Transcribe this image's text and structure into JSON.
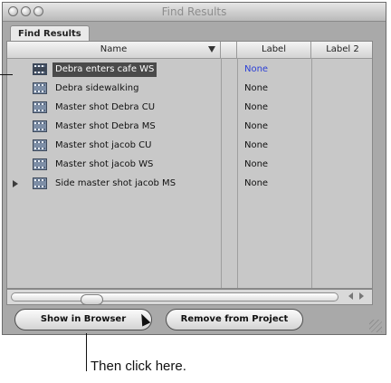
{
  "window": {
    "title": "Find Results"
  },
  "tab": {
    "label": "Find Results"
  },
  "table": {
    "headers": {
      "name": "Name",
      "label": "Label",
      "label2": "Label 2"
    },
    "rows": [
      {
        "name": "Debra enters cafe WS",
        "label": "None",
        "selected": true,
        "expandable": false
      },
      {
        "name": "Debra sidewalking",
        "label": "None",
        "selected": false,
        "expandable": false
      },
      {
        "name": "Master shot Debra CU",
        "label": "None",
        "selected": false,
        "expandable": false
      },
      {
        "name": "Master shot Debra MS",
        "label": "None",
        "selected": false,
        "expandable": false
      },
      {
        "name": "Master shot jacob CU",
        "label": "None",
        "selected": false,
        "expandable": false
      },
      {
        "name": "Master shot jacob WS",
        "label": "None",
        "selected": false,
        "expandable": false
      },
      {
        "name": "Side master shot jacob MS",
        "label": "None",
        "selected": false,
        "expandable": true
      }
    ]
  },
  "buttons": {
    "show_in_browser": "Show in Browser",
    "remove_from_project": "Remove from Project"
  },
  "annotation": {
    "text": "Then click here."
  },
  "colors": {
    "selection": "#4a4a4a",
    "selected_label": "#2b3fd6"
  }
}
